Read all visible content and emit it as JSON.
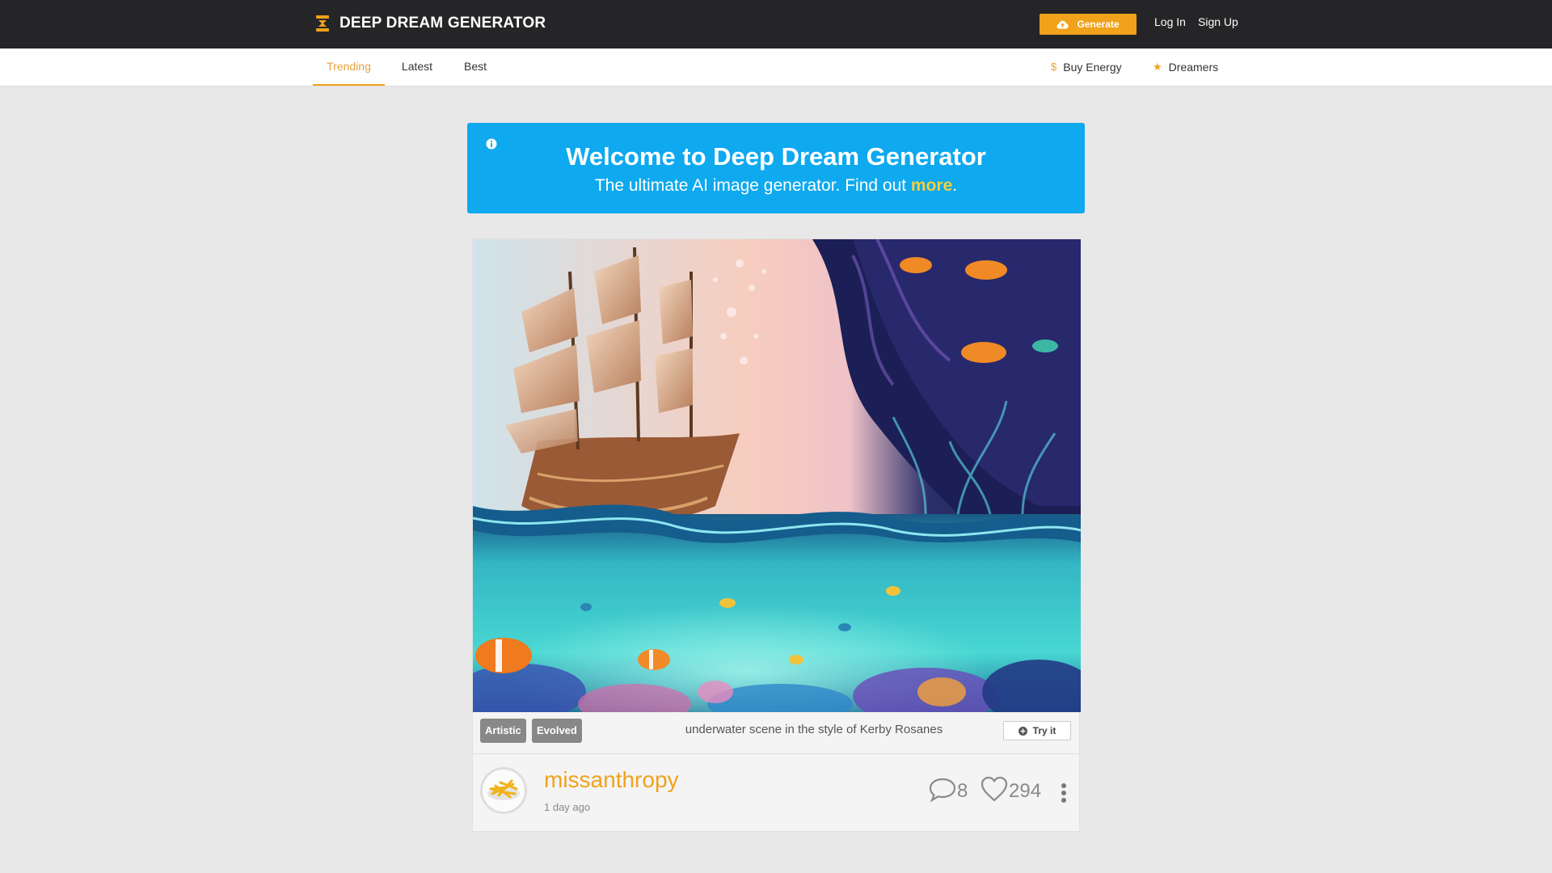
{
  "brand": {
    "name": "DEEP DREAM GENERATOR",
    "accent": "#f0a21b",
    "topbar_bg": "#252527",
    "banner_bg": "#0ea9ef"
  },
  "header": {
    "generate_label": "Generate",
    "login_label": "Log In",
    "signup_label": "Sign Up"
  },
  "tabs": [
    {
      "label": "Trending",
      "active": true
    },
    {
      "label": "Latest",
      "active": false
    },
    {
      "label": "Best",
      "active": false
    }
  ],
  "right_nav": {
    "buy_energy": {
      "icon": "dollar-icon",
      "label": "Buy Energy"
    },
    "dreamers": {
      "icon": "star-icon",
      "label": "Dreamers"
    }
  },
  "banner": {
    "title": "Welcome to Deep Dream Generator",
    "subtitle_prefix": "The ultimate AI image generator. Find out ",
    "subtitle_link": "more",
    "subtitle_suffix": "."
  },
  "post": {
    "image_alt": "underwater scene with sailing ship and tropical fish",
    "badges": [
      "Artistic",
      "Evolved"
    ],
    "prompt": "underwater scene in the style of Kerby Rosanes",
    "try_label": "Try it",
    "username": "missanthropy",
    "time_ago": "1 day ago",
    "comments": "8",
    "likes": "294"
  }
}
